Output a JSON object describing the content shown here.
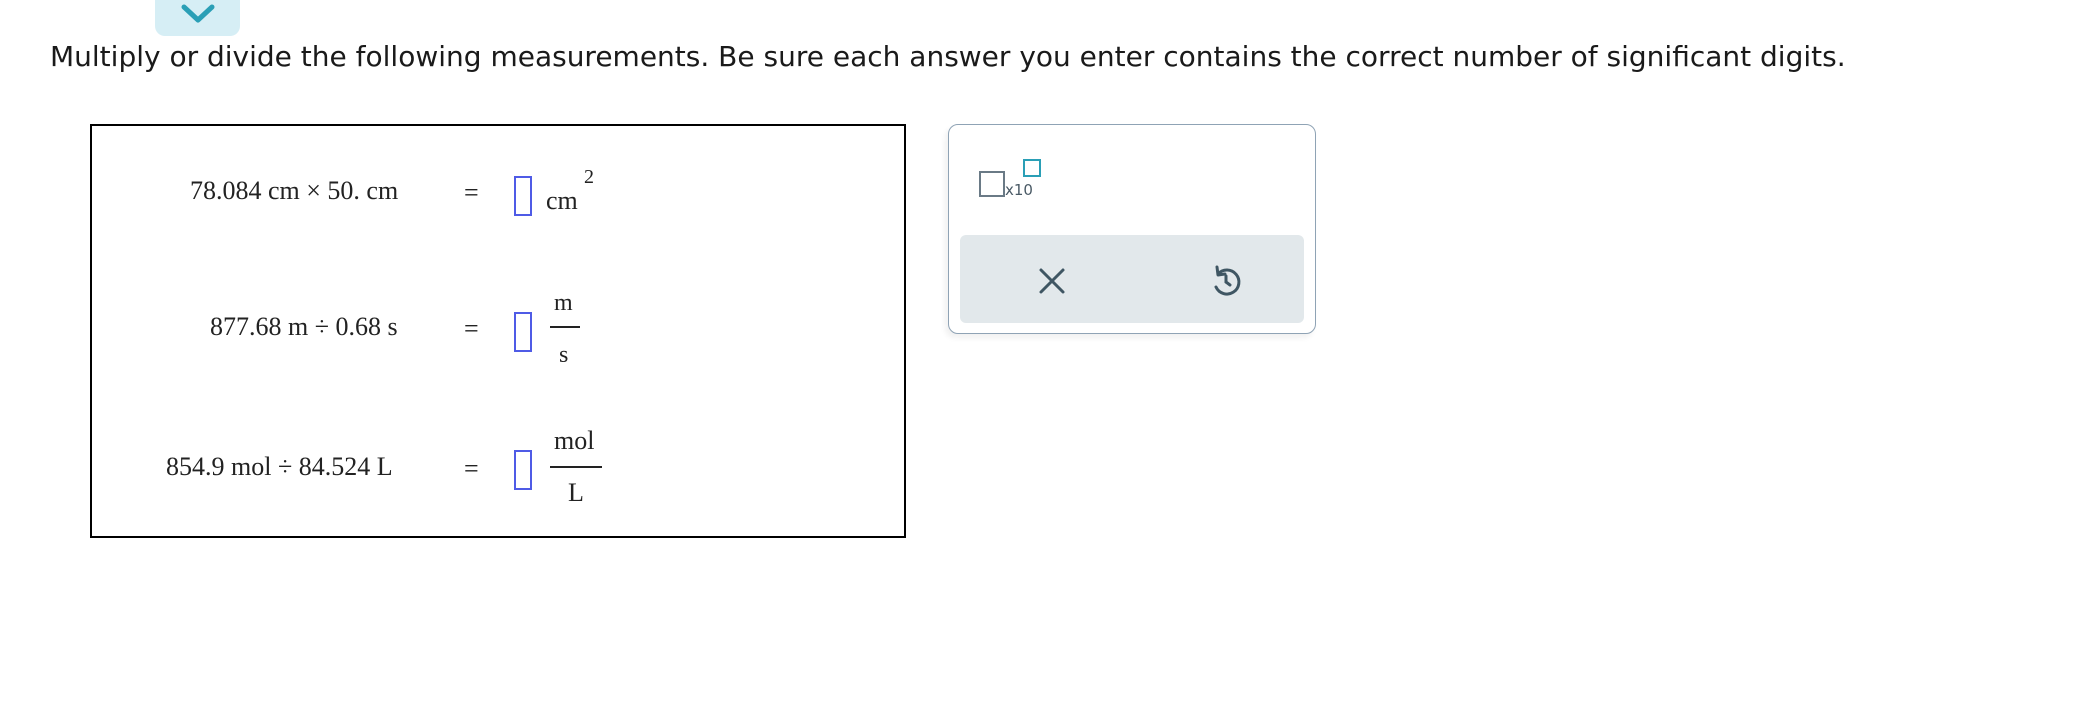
{
  "instructions": "Multiply or divide the following measurements. Be sure each answer you enter contains the correct number of significant digits.",
  "problems": [
    {
      "expression": "78.084 cm × 50. cm",
      "equals": "=",
      "unit": "cm",
      "exponent": "2"
    },
    {
      "expression": "877.68 m ÷ 0.68 s",
      "equals": "=",
      "unit_numerator": "m",
      "unit_denominator": "s"
    },
    {
      "expression": "854.9 mol ÷ 84.524 L",
      "equals": "=",
      "unit_numerator": "mol",
      "unit_denominator": "L"
    }
  ],
  "tools": {
    "sci_notation_label": "x10",
    "clear_icon": "x-icon",
    "undo_icon": "undo-icon"
  },
  "colors": {
    "slot_border": "#4f5be6",
    "tab_bg": "#d6eef5",
    "chevron": "#2a9fb6",
    "action_bar": "#e2e8eb"
  }
}
